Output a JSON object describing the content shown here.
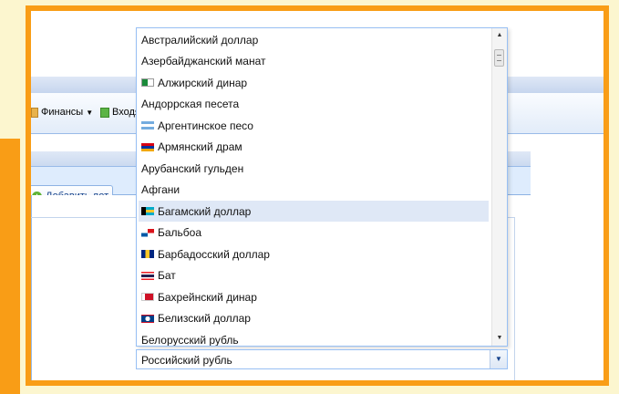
{
  "toolbar": {
    "finance_label": "Финансы",
    "incoming_label": "Входящ"
  },
  "tabs": {
    "add_lot_label": "Добавить лот"
  },
  "currency_select": {
    "selected_value": "Российский рубль",
    "highlighted_index": 8,
    "options": [
      {
        "label": "Австралийский доллар",
        "flag": ""
      },
      {
        "label": "Азербайджанский манат",
        "flag": ""
      },
      {
        "label": "Алжирский динар",
        "flag": "algeria-flag-icon"
      },
      {
        "label": "Андоррская песета",
        "flag": ""
      },
      {
        "label": "Аргентинское песо",
        "flag": "argentina-flag-icon"
      },
      {
        "label": "Армянский драм",
        "flag": "armenia-flag-icon"
      },
      {
        "label": "Арубанский гульден",
        "flag": ""
      },
      {
        "label": "Афгани",
        "flag": ""
      },
      {
        "label": "Багамский доллар",
        "flag": "bahamas-flag-icon"
      },
      {
        "label": "Бальбоа",
        "flag": "panama-flag-icon"
      },
      {
        "label": "Барбадосский доллар",
        "flag": "barbados-flag-icon"
      },
      {
        "label": "Бат",
        "flag": "thailand-flag-icon"
      },
      {
        "label": "Бахрейнский динар",
        "flag": "bahrain-flag-icon"
      },
      {
        "label": "Белизский доллар",
        "flag": "belize-flag-icon"
      },
      {
        "label": "Белорусский рубль",
        "flag": ""
      }
    ]
  },
  "colors": {
    "frame": "#f99d16",
    "highlight": "#dfe8f6",
    "border": "#98c0f4"
  }
}
